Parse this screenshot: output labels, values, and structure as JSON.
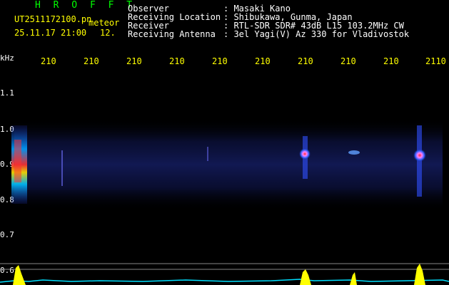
{
  "header": {
    "title": "H R O F F T",
    "filename": "UT2511172100.pn",
    "meteor_label": "meteor",
    "datetime": "25.11.17 21:00",
    "count": "12.",
    "observer_label": "Observer",
    "observer_value": ": Masaki Kano",
    "location_label": "Receiving Location",
    "location_value": ": Shibukawa, Gunma, Japan",
    "receiver_label": "Receiver",
    "receiver_value": ": RTL-SDR SDR# 43dB L15 103.2MHz CW",
    "antenna_label": "Receiving Antenna",
    "antenna_value": ": 3el Yagi(V) Az 330 for Vladivostok"
  },
  "axes": {
    "y_unit": "kHz",
    "y_ticks": [
      "1.1",
      "1.0",
      "0.9",
      "0.8",
      "0.7",
      "0.6"
    ],
    "x_ticks": [
      "210",
      "210",
      "210",
      "210",
      "210",
      "210",
      "210",
      "210",
      "210",
      "2110"
    ]
  },
  "colors": {
    "title": "#00ff00",
    "filename": "#ffff00",
    "info": "#ffffff",
    "x_ticks": "#ffff00",
    "y_ticks": "#ffffff",
    "noise": "#1e2c9c",
    "signal": "#ff3030",
    "baseline": "#00e0ff",
    "peak": "#ffff00"
  },
  "chart_data": {
    "type": "heatmap",
    "y_range_khz": [
      0.59,
      1.14
    ],
    "echo_columns_minutes": [
      0.2,
      6.75,
      9.3
    ],
    "echo_center_khz": 0.92
  }
}
